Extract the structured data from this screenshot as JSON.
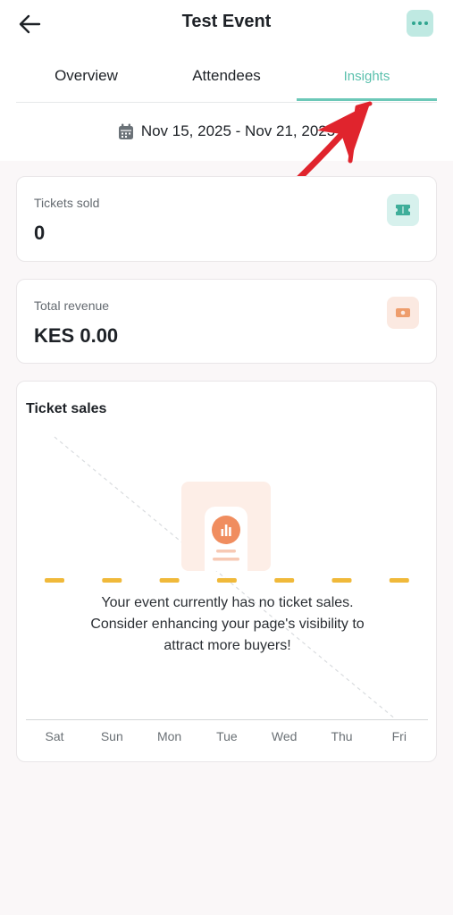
{
  "header": {
    "title": "Test Event",
    "back_icon": "arrow-left-icon",
    "more_icon": "more-dots-icon",
    "accent_color": "#5bc0ad"
  },
  "tabs": [
    {
      "label": "Overview",
      "active": false
    },
    {
      "label": "Attendees",
      "active": false
    },
    {
      "label": "Insights",
      "active": true
    }
  ],
  "date_range": {
    "icon": "calendar-icon",
    "text": "Nov 15, 2025 - Nov 21, 2025"
  },
  "stats": {
    "tickets": {
      "label": "Tickets sold",
      "value": "0",
      "icon": "ticket-icon"
    },
    "revenue": {
      "label": "Total revenue",
      "value": "KES 0.00",
      "icon": "cash-icon"
    }
  },
  "chart": {
    "title": "Ticket sales",
    "empty_message": [
      "Your event currently has no ticket sales.",
      "Consider enhancing your page's visibility to",
      "attract more buyers!"
    ]
  },
  "chart_data": {
    "type": "bar",
    "title": "Ticket sales",
    "categories": [
      "Sat",
      "Sun",
      "Mon",
      "Tue",
      "Wed",
      "Thu",
      "Fri"
    ],
    "values": [
      0,
      0,
      0,
      0,
      0,
      0,
      0
    ],
    "xlabel": "",
    "ylabel": "",
    "grid": false,
    "bar_color": "#f0b93a"
  }
}
